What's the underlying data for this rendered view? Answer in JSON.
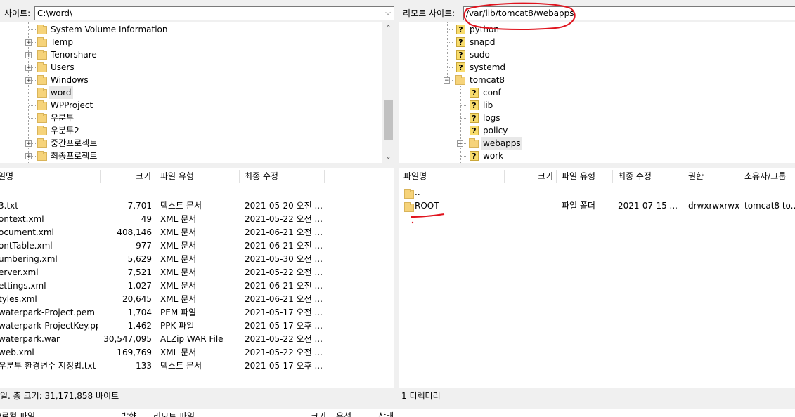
{
  "local": {
    "site_label": "사이트:",
    "path": "C:\\word\\",
    "tree": [
      {
        "name": "System Volume Information",
        "expand": false
      },
      {
        "name": "Temp",
        "expand": true
      },
      {
        "name": "Tenorshare",
        "expand": true
      },
      {
        "name": "Users",
        "expand": true
      },
      {
        "name": "Windows",
        "expand": true
      },
      {
        "name": "word",
        "expand": false,
        "selected": true
      },
      {
        "name": "WPProject",
        "expand": false
      },
      {
        "name": "우분투",
        "expand": false
      },
      {
        "name": "우분투2",
        "expand": false
      },
      {
        "name": "중간프로젝트",
        "expand": true
      },
      {
        "name": "최종프로젝트",
        "expand": true
      }
    ],
    "columns": [
      "일명",
      "크기",
      "파일 유형",
      "최종 수정"
    ],
    "files": [
      {
        "name": "3.txt",
        "size": "7,701",
        "type": "텍스트 문서",
        "modified": "2021-05-20 오전 ..."
      },
      {
        "name": "ontext.xml",
        "size": "49",
        "type": "XML 문서",
        "modified": "2021-05-22 오전 ..."
      },
      {
        "name": "ocument.xml",
        "size": "408,146",
        "type": "XML 문서",
        "modified": "2021-06-21 오전 ..."
      },
      {
        "name": "ontTable.xml",
        "size": "977",
        "type": "XML 문서",
        "modified": "2021-06-21 오전 ..."
      },
      {
        "name": "umbering.xml",
        "size": "5,629",
        "type": "XML 문서",
        "modified": "2021-05-30 오전 ..."
      },
      {
        "name": "erver.xml",
        "size": "7,521",
        "type": "XML 문서",
        "modified": "2021-05-22 오전 ..."
      },
      {
        "name": "ettings.xml",
        "size": "1,027",
        "type": "XML 문서",
        "modified": "2021-06-21 오전 ..."
      },
      {
        "name": "tyles.xml",
        "size": "20,645",
        "type": "XML 문서",
        "modified": "2021-06-21 오전 ..."
      },
      {
        "name": "waterpark-Project.pem",
        "size": "1,704",
        "type": "PEM 파일",
        "modified": "2021-05-17 오전 ..."
      },
      {
        "name": "waterpark-ProjectKey.ppk",
        "size": "1,462",
        "type": "PPK 파일",
        "modified": "2021-05-17 오후 ..."
      },
      {
        "name": "waterpark.war",
        "size": "30,547,095",
        "type": "ALZip WAR File",
        "modified": "2021-05-22 오전 ..."
      },
      {
        "name": "web.xml",
        "size": "169,769",
        "type": "XML 문서",
        "modified": "2021-05-22 오전 ..."
      },
      {
        "name": "우분투 환경변수 지정법.txt",
        "size": "133",
        "type": "텍스트 문서",
        "modified": "2021-05-17 오후 ..."
      }
    ],
    "status": "일. 총 크기: 31,171,858 바이트"
  },
  "remote": {
    "site_label": "리모트 사이트:",
    "path": "/var/lib/tomcat8/webapps",
    "tree": [
      {
        "name": "python",
        "icon": "question",
        "level": 0
      },
      {
        "name": "snapd",
        "icon": "question",
        "level": 0
      },
      {
        "name": "sudo",
        "icon": "question",
        "level": 0
      },
      {
        "name": "systemd",
        "icon": "question",
        "level": 0
      },
      {
        "name": "tomcat8",
        "icon": "folder",
        "level": 0,
        "collapse": true
      },
      {
        "name": "conf",
        "icon": "question",
        "level": 1
      },
      {
        "name": "lib",
        "icon": "question",
        "level": 1
      },
      {
        "name": "logs",
        "icon": "question",
        "level": 1
      },
      {
        "name": "policy",
        "icon": "question",
        "level": 1
      },
      {
        "name": "webapps",
        "icon": "folder",
        "level": 1,
        "expand": true,
        "selected": true
      },
      {
        "name": "work",
        "icon": "question",
        "level": 1
      }
    ],
    "columns": [
      "파일명",
      "크기",
      "파일 유형",
      "최종 수정",
      "권한",
      "소유자/그룹"
    ],
    "files": [
      {
        "name": "..",
        "type": "",
        "modified": "",
        "perm": "",
        "owner": ""
      },
      {
        "name": "ROOT",
        "type": "파일 폴더",
        "modified": "2021-07-15 ...",
        "perm": "drwxrwxrwx",
        "owner": "tomcat8 to..."
      }
    ],
    "status": "1 디렉터리"
  },
  "queue": {
    "columns": [
      "/로컬 파일",
      "방향",
      "리모트 파일",
      "크기",
      "우선",
      "상태"
    ]
  },
  "colors": {
    "annotation": "#e0141e",
    "folder": "#f6d37a",
    "selected": "#e8e8e8"
  }
}
